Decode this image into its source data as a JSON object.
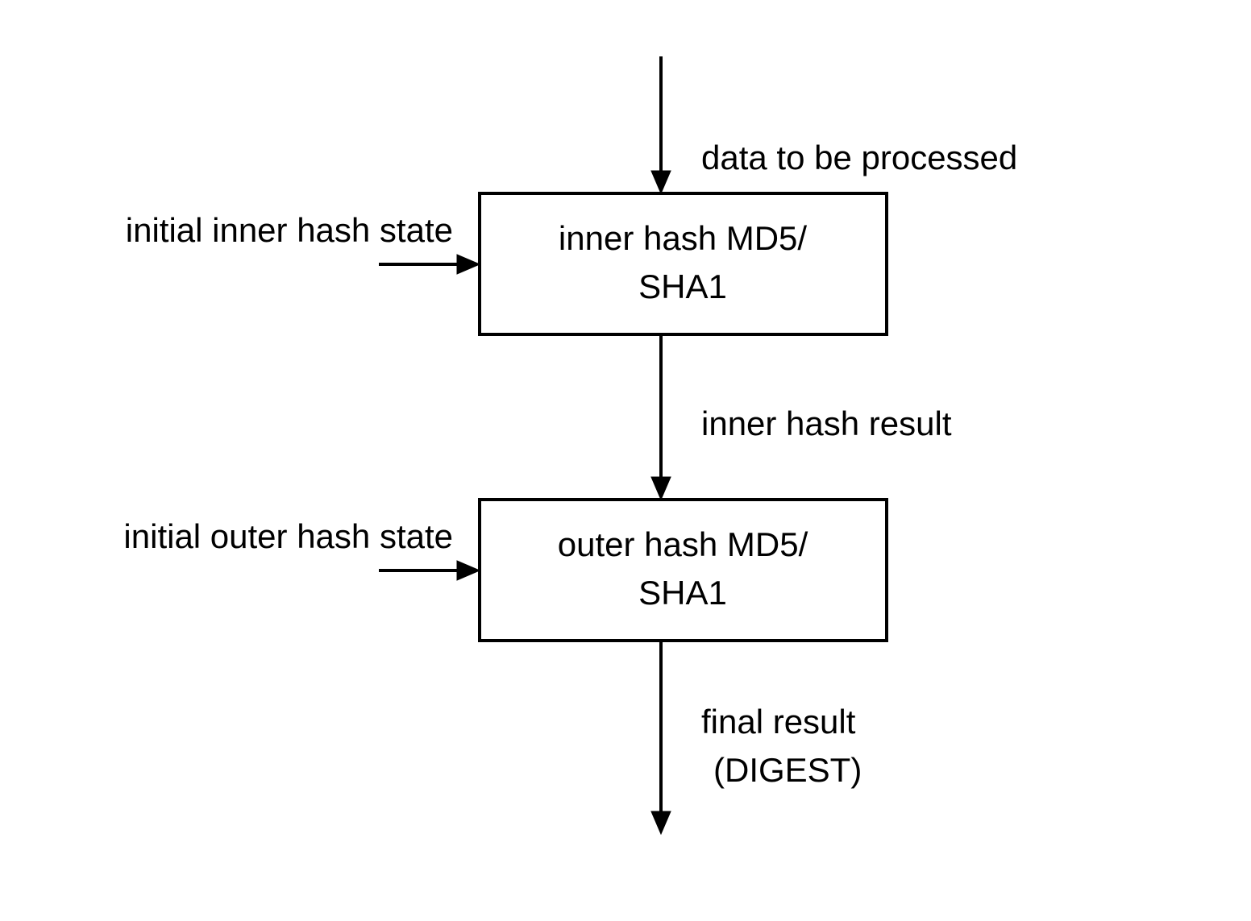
{
  "diagram": {
    "top_input_label": "data to be processed",
    "inner_box_line1": "inner hash MD5/",
    "inner_box_line2": "SHA1",
    "inner_left_label": "initial inner hash state",
    "middle_arrow_label": "inner hash result",
    "outer_box_line1": "outer hash MD5/",
    "outer_box_line2": "SHA1",
    "outer_left_label": "initial outer hash state",
    "final_label_line1": "final result",
    "final_label_line2": "(DIGEST)"
  }
}
